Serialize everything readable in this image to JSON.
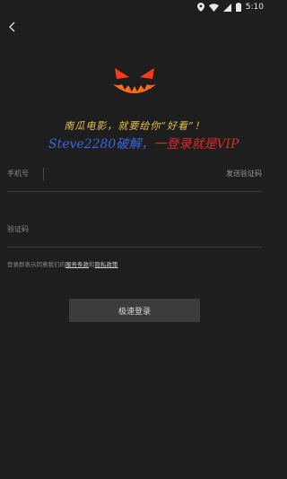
{
  "status_bar": {
    "time": "5:10",
    "icons": [
      "notification-icon",
      "location-icon",
      "wifi-icon",
      "signal-icon",
      "battery-icon"
    ]
  },
  "nav": {
    "back_icon": "back-arrow-icon"
  },
  "logo": {
    "icon": "pumpkin-face-logo",
    "colors": {
      "eyes": "#ff3a1a",
      "glow": "#ff7a1a"
    }
  },
  "slogan": "南瓜电影，就要给你“好看”！",
  "promo": {
    "part1": "Steve2280破解，",
    "part2": "一登录就是VIP"
  },
  "form": {
    "phone_label": "手机号",
    "phone_value": "",
    "phone_placeholder": "",
    "get_code_label": "发送验证码",
    "code_label": "",
    "code_placeholder": "验证码",
    "code_value": ""
  },
  "agreement": {
    "prefix": "登录即表示同意我们的",
    "terms_link": "服务条款",
    "conjunction": "和",
    "privacy_link": "隐私政策"
  },
  "login_button_label": "极速登录",
  "colors": {
    "background": "#1e1e1e",
    "button": "#3c3c3c",
    "slogan": "#e6c24a",
    "promo_blue": "#3a67e0",
    "promo_red": "#d92a2a"
  }
}
